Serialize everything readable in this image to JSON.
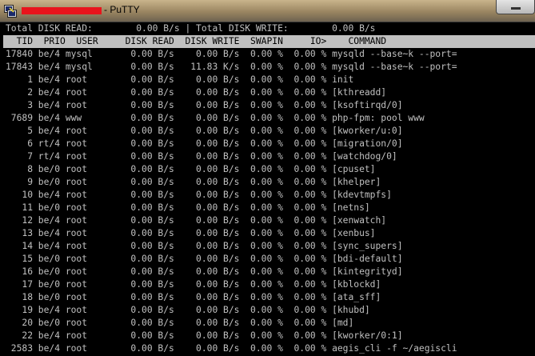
{
  "window": {
    "title": "- PuTTY",
    "icon": "putty-icon",
    "redaction_color": "#e8141c"
  },
  "iotop": {
    "summary": "Total DISK READ:        0.00 B/s | Total DISK WRITE:        0.00 B/s",
    "header": "  TID  PRIO  USER     DISK READ  DISK WRITE  SWAPIN     IO>    COMMAND",
    "rows": [
      "17840 be/4 mysql       0.00 B/s    0.00 B/s  0.00 %  0.00 % mysqld --base~k --port=",
      "17843 be/4 mysql       0.00 B/s   11.83 K/s  0.00 %  0.00 % mysqld --base~k --port=",
      "    1 be/4 root        0.00 B/s    0.00 B/s  0.00 %  0.00 % init",
      "    2 be/4 root        0.00 B/s    0.00 B/s  0.00 %  0.00 % [kthreadd]",
      "    3 be/4 root        0.00 B/s    0.00 B/s  0.00 %  0.00 % [ksoftirqd/0]",
      " 7689 be/4 www         0.00 B/s    0.00 B/s  0.00 %  0.00 % php-fpm: pool www",
      "    5 be/4 root        0.00 B/s    0.00 B/s  0.00 %  0.00 % [kworker/u:0]",
      "    6 rt/4 root        0.00 B/s    0.00 B/s  0.00 %  0.00 % [migration/0]",
      "    7 rt/4 root        0.00 B/s    0.00 B/s  0.00 %  0.00 % [watchdog/0]",
      "    8 be/0 root        0.00 B/s    0.00 B/s  0.00 %  0.00 % [cpuset]",
      "    9 be/0 root        0.00 B/s    0.00 B/s  0.00 %  0.00 % [khelper]",
      "   10 be/4 root        0.00 B/s    0.00 B/s  0.00 %  0.00 % [kdevtmpfs]",
      "   11 be/0 root        0.00 B/s    0.00 B/s  0.00 %  0.00 % [netns]",
      "   12 be/4 root        0.00 B/s    0.00 B/s  0.00 %  0.00 % [xenwatch]",
      "   13 be/4 root        0.00 B/s    0.00 B/s  0.00 %  0.00 % [xenbus]",
      "   14 be/4 root        0.00 B/s    0.00 B/s  0.00 %  0.00 % [sync_supers]",
      "   15 be/0 root        0.00 B/s    0.00 B/s  0.00 %  0.00 % [bdi-default]",
      "   16 be/0 root        0.00 B/s    0.00 B/s  0.00 %  0.00 % [kintegrityd]",
      "   17 be/0 root        0.00 B/s    0.00 B/s  0.00 %  0.00 % [kblockd]",
      "   18 be/0 root        0.00 B/s    0.00 B/s  0.00 %  0.00 % [ata_sff]",
      "   19 be/4 root        0.00 B/s    0.00 B/s  0.00 %  0.00 % [khubd]",
      "   20 be/0 root        0.00 B/s    0.00 B/s  0.00 %  0.00 % [md]",
      "   22 be/4 root        0.00 B/s    0.00 B/s  0.00 %  0.00 % [kworker/0:1]",
      " 2583 be/4 root        0.00 B/s    0.00 B/s  0.00 %  0.00 % aegis_cli -f ~/aegiscli"
    ]
  }
}
